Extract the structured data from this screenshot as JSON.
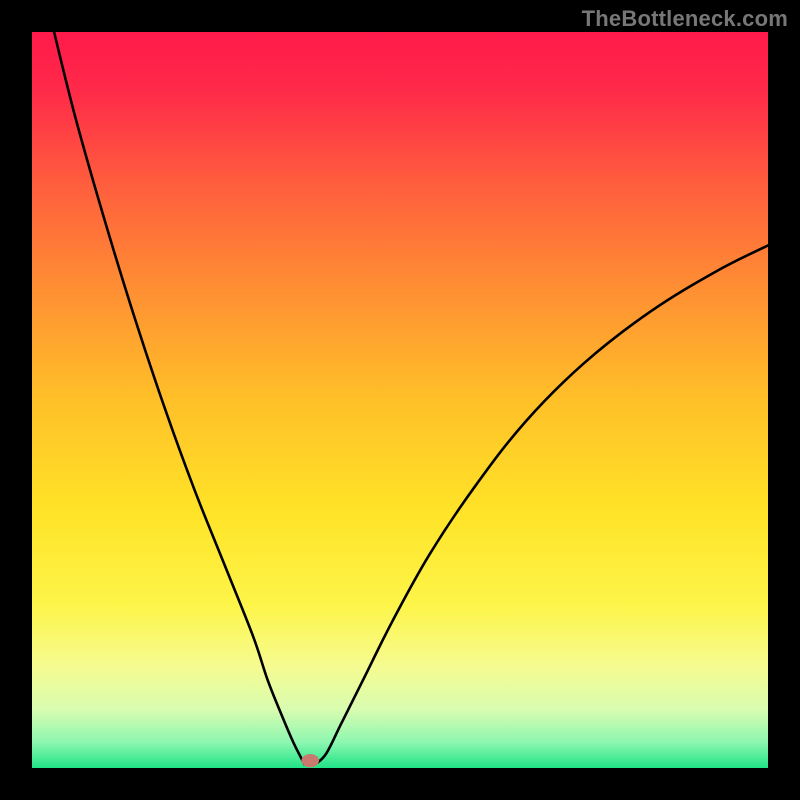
{
  "watermark": "TheBottleneck.com",
  "chart_data": {
    "type": "line",
    "title": "",
    "xlabel": "",
    "ylabel": "",
    "xlim": [
      0,
      100
    ],
    "ylim": [
      0,
      100
    ],
    "grid": false,
    "legend": false,
    "gradient_stops": [
      {
        "offset": 0.0,
        "color": "#ff1a4b"
      },
      {
        "offset": 0.08,
        "color": "#ff2a49"
      },
      {
        "offset": 0.2,
        "color": "#ff5b3e"
      },
      {
        "offset": 0.35,
        "color": "#ff8f33"
      },
      {
        "offset": 0.5,
        "color": "#ffc028"
      },
      {
        "offset": 0.65,
        "color": "#ffe327"
      },
      {
        "offset": 0.78,
        "color": "#fdf54a"
      },
      {
        "offset": 0.86,
        "color": "#f6fb8f"
      },
      {
        "offset": 0.92,
        "color": "#d9fcb0"
      },
      {
        "offset": 0.965,
        "color": "#8df7b0"
      },
      {
        "offset": 1.0,
        "color": "#20e387"
      }
    ],
    "series": [
      {
        "name": "left-branch",
        "x": [
          3,
          6,
          10,
          14,
          18,
          22,
          26,
          30,
          32,
          34,
          35.5,
          36.5,
          37
        ],
        "y": [
          100,
          88,
          74,
          61,
          49,
          38,
          28,
          18,
          12,
          7,
          3.5,
          1.5,
          0.5
        ]
      },
      {
        "name": "right-branch",
        "x": [
          38.5,
          40,
          42,
          45,
          49,
          54,
          60,
          67,
          75,
          84,
          93,
          100
        ],
        "y": [
          0.5,
          2,
          6,
          12,
          20,
          29,
          38,
          47,
          55,
          62,
          67.5,
          71
        ]
      }
    ],
    "marker": {
      "name": "min-point",
      "x": 37.8,
      "y": 1.0,
      "rx": 1.2,
      "ry": 0.9,
      "color": "#c97a6e"
    }
  }
}
